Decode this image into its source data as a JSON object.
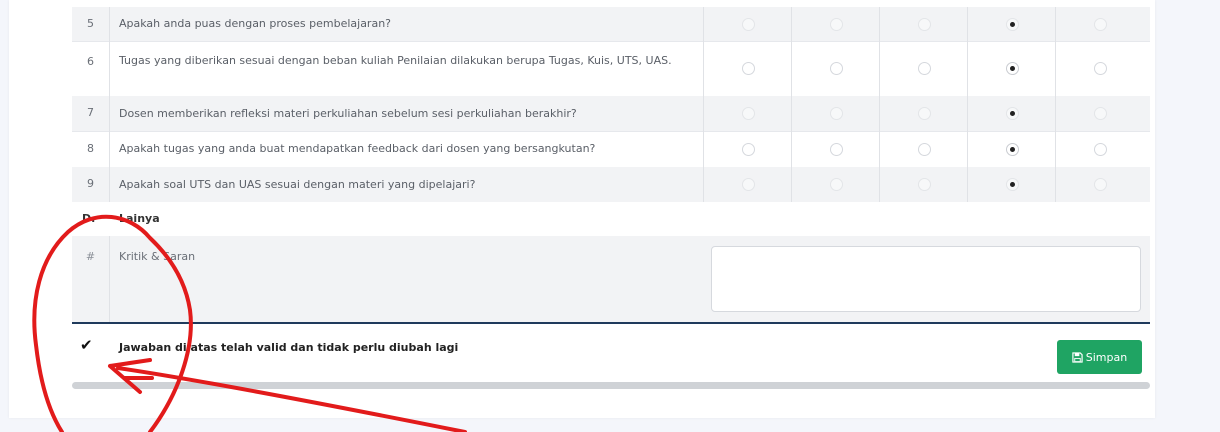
{
  "questions": [
    {
      "no": "5",
      "text": "Apakah anda puas dengan proses pembelajaran?",
      "selected": 3
    },
    {
      "no": "6",
      "text": "Tugas yang diberikan sesuai dengan beban kuliah Penilaian dilakukan berupa Tugas, Kuis, UTS, UAS.",
      "selected": 3
    },
    {
      "no": "7",
      "text": "Dosen memberikan refleksi materi perkuliahan sebelum sesi perkuliahan berakhir?",
      "selected": 3
    },
    {
      "no": "8",
      "text": "Apakah tugas yang anda buat mendapatkan feedback dari dosen yang bersangkutan?",
      "selected": 3
    },
    {
      "no": "9",
      "text": "Apakah soal UTS dan UAS sesuai dengan materi yang dipelajari?",
      "selected": 3
    }
  ],
  "section": {
    "letter": "D.",
    "title": "Lainya"
  },
  "saran": {
    "no": "#",
    "label": "Kritik & Saran",
    "value": ""
  },
  "confirm": {
    "checked": true,
    "text": "Jawaban di atas telah valid dan tidak perlu diubah lagi"
  },
  "save_button": {
    "label": "Simpan",
    "icon": "floppy-disk-icon",
    "color": "#1fa463"
  },
  "annotation": {
    "color": "#e21b1b"
  }
}
